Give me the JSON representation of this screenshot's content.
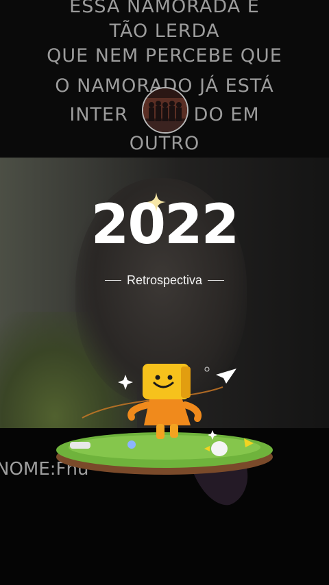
{
  "caption": {
    "lines": [
      "ESSA NAMORADA E",
      "TÃO LERDA",
      "QUE NEM PERCEBE QUE",
      "O NAMORADO JÁ ESTÁ",
      "INTER          DO EM",
      "OUTRO"
    ]
  },
  "overlay": {
    "year": "2022",
    "subtitle": "Retrospectiva"
  },
  "lower": {
    "text": "NOME:Fhu"
  },
  "icons": {
    "sparkle": "sparkle-icon",
    "paper_plane": "paper-plane-icon",
    "mascot": "smiley-box-mascot",
    "avatar": "profile-avatar"
  },
  "colors": {
    "caption_text": "#9c9c9c",
    "title_text": "#ffffff",
    "mascot_orange": "#f08a1c",
    "grass": "#6fb33c"
  }
}
